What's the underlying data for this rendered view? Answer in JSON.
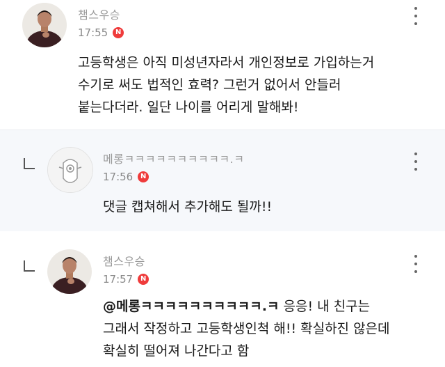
{
  "comments": [
    {
      "author": "챔스우승",
      "time": "17:55",
      "badge": "N",
      "lines": [
        "고등학생은 아직 미성년자라서 개인정보로 가입하는거",
        "수기로 써도 법적인 효력? 그런거 없어서 안들러",
        "붙는다더라. 일단 나이를 어리게 말해봐!"
      ]
    },
    {
      "author": "메롱ㅋㅋㅋㅋㅋㅋㅋㅋㅋㅋ.ㅋ",
      "time": "17:56",
      "badge": "N",
      "lines": [
        "댓글 캡쳐해서 추가해도 될까!!"
      ]
    },
    {
      "author": "챔스우승",
      "time": "17:57",
      "badge": "N",
      "mention": "@메롱ㅋㅋㅋㅋㅋㅋㅋㅋㅋㅋ.ㅋ",
      "first_line_rest": " 응응! 내 친구는",
      "lines": [
        "그래서 작정하고 고등학생인척 해!! 확실하진 않은데",
        "확실히 떨어져 나간다고 함"
      ]
    }
  ],
  "icons": {
    "more": "more-vertical-icon",
    "reply": "reply-arrow-icon",
    "new": "new-badge"
  },
  "colors": {
    "badge": "#ef3b3b",
    "reply_bg": "#f6f8fb",
    "meta_text": "#9a9a9a"
  }
}
